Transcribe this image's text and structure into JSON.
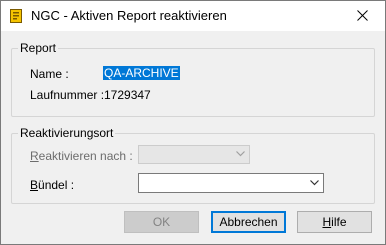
{
  "window": {
    "title": "NGC - Aktiven Report reaktivieren",
    "icon": "ngc-app-icon",
    "close_icon": "close-icon"
  },
  "report_group": {
    "title": "Report",
    "name_label": "Name :",
    "name_value": "QA-ARCHIVE",
    "number_label": "Laufnummer :",
    "number_value": "1729347"
  },
  "reactivation_group": {
    "title": "Reaktivierungsort",
    "reactivate_label_access": "R",
    "reactivate_label_rest": "eaktivieren nach :",
    "reactivate_value": "",
    "bundle_label_access": "B",
    "bundle_label_rest": "ündel :",
    "bundle_value": ""
  },
  "buttons": {
    "ok": "OK",
    "cancel": "Abbrechen",
    "help_access": "H",
    "help_rest": "ilfe"
  }
}
